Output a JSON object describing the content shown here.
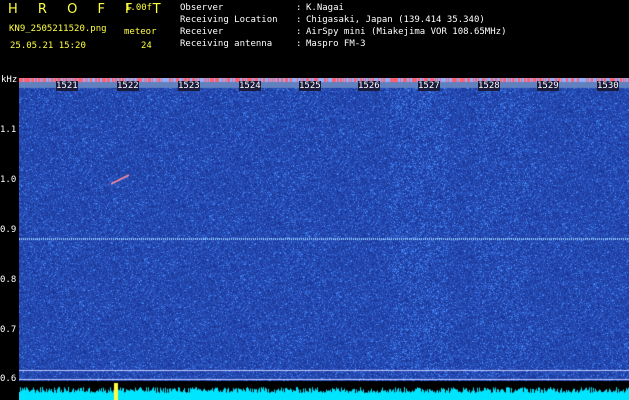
{
  "header": {
    "app_title": "H R O F F T",
    "version": "1.00f",
    "filename": "KN9_2505211520.png",
    "datetime": "25.05.21 15:20",
    "meteor_label": "meteor",
    "meteor_count": "24",
    "info": [
      {
        "key": "Observer",
        "sep": ":",
        "value": "K.Nagai"
      },
      {
        "key": "Receiving Location",
        "sep": ":",
        "value": "Chigasaki, Japan (139.414 35.340)"
      },
      {
        "key": "Receiver",
        "sep": ":",
        "value": "AirSpy mini (Miakejima VOR 108.65MHz)"
      },
      {
        "key": "Receiving antenna",
        "sep": ":",
        "value": "Maspro FM-3"
      }
    ]
  },
  "axis": {
    "y_unit": "kHz",
    "y_ticks": [
      "1.1",
      "1.0",
      "0.9",
      "0.8",
      "0.7",
      "0.6"
    ],
    "x_ticks": [
      "1521",
      "1522",
      "1523",
      "1524",
      "1525",
      "1526",
      "1527",
      "1528",
      "1529",
      "1530"
    ]
  },
  "colors": {
    "background": "#000000",
    "waterfall_bg": "#0a1575",
    "label_yellow": "#ffff40",
    "spectrum": "#00e5ff"
  }
}
